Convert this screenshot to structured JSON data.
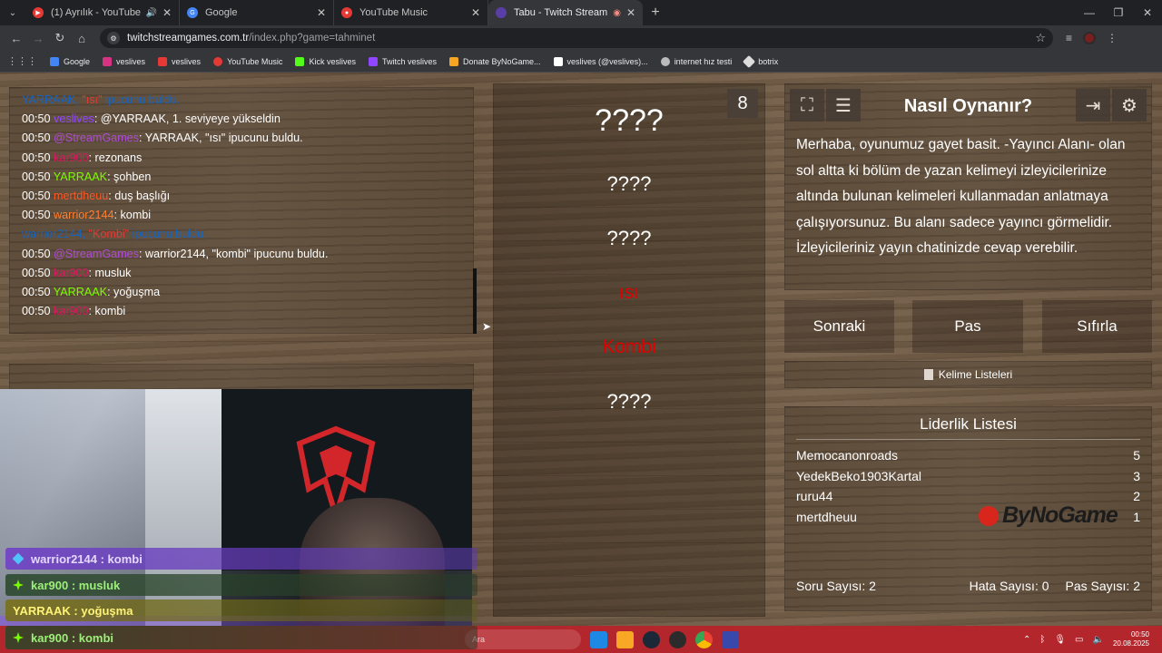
{
  "browser": {
    "tabs": [
      {
        "title": "(1) Ayrılık - YouTube",
        "fav_color": "#e53935",
        "extra": "🔊"
      },
      {
        "title": "Google",
        "fav_color": "#4285f4",
        "extra": ""
      },
      {
        "title": "YouTube Music",
        "fav_color": "#e53935",
        "extra": ""
      },
      {
        "title": "Tabu - Twitch Stream Game",
        "fav_color": "#5a3ea8",
        "extra": "◉"
      }
    ],
    "url_host": "twitchstreamgames.com.tr",
    "url_path": "/index.php?game=tahminet",
    "bookmarks": [
      {
        "label": "Google",
        "color": "#4285f4"
      },
      {
        "label": "veslives",
        "color": "#d63384"
      },
      {
        "label": "veslives",
        "color": "#e53935"
      },
      {
        "label": "YouTube Music",
        "color": "#e53935"
      },
      {
        "label": "Kick veslives",
        "color": "#53fc18"
      },
      {
        "label": "Twitch veslives",
        "color": "#9146ff"
      },
      {
        "label": "Donate ByNoGame...",
        "color": "#f5a623"
      },
      {
        "label": "veslives (@veslives)...",
        "color": "#ffffff"
      },
      {
        "label": "internet hız testi",
        "color": "#bbbbbb"
      },
      {
        "label": "botrix",
        "color": "#dddddd"
      }
    ]
  },
  "chat": {
    "lines": [
      {
        "type": "sys",
        "user": "YARRAAK",
        "sep": ",  ",
        "word": "\"ısı\"",
        "suffix": " ipucunu buldu."
      },
      {
        "type": "msg",
        "time": "00:50",
        "user": "veslives",
        "color": "#9146ff",
        "text": ": @YARRAAK, 1. seviyeye yükseldin"
      },
      {
        "type": "msg",
        "time": "00:50",
        "user": "@StreamGames",
        "color": "#b04ad6",
        "text": ": YARRAAK, \"ısı\" ipucunu buldu."
      },
      {
        "type": "msg",
        "time": "00:50",
        "user": "kar900",
        "color": "#d81b60",
        "text": ": rezonans"
      },
      {
        "type": "msg",
        "time": "00:50",
        "user": "YARRAAK",
        "color": "#7cfc00",
        "text": ": şohben"
      },
      {
        "type": "msg",
        "time": "00:50",
        "user": "mertdheuu",
        "color": "#ff5722",
        "text": ": duş başlığı"
      },
      {
        "type": "msg",
        "time": "00:50",
        "user": "warrior2144",
        "color": "#ff7f32",
        "text": ": kombi"
      },
      {
        "type": "sys",
        "user": "warrior2144",
        "sep": ",  ",
        "word": "\"Kombi\"",
        "suffix": " ipucunu buldu."
      },
      {
        "type": "msg",
        "time": "00:50",
        "user": "@StreamGames",
        "color": "#b04ad6",
        "text": ": warrior2144, \"kombi\" ipucunu buldu."
      },
      {
        "type": "msg",
        "time": "00:50",
        "user": "kar900",
        "color": "#d81b60",
        "text": ": musluk"
      },
      {
        "type": "msg",
        "time": "00:50",
        "user": "YARRAAK",
        "color": "#7cfc00",
        "text": ": yoğuşma"
      },
      {
        "type": "msg",
        "time": "00:50",
        "user": "kar900",
        "color": "#d81b60",
        "text": ": kombi"
      }
    ]
  },
  "overlay": {
    "messages": [
      "warrior2144 : kombi",
      "kar900 : musluk",
      "YARRAAK : yoğuşma",
      "kar900 : kombi"
    ]
  },
  "card": {
    "number": "8",
    "words": [
      "????",
      "????",
      "????",
      "ısı",
      "Kombi",
      "????"
    ]
  },
  "howto": {
    "title": "Nasıl Oynanır?",
    "text": "Merhaba, oyunumuz gayet basit. -Yayıncı Alanı- olan sol altta ki bölüm de yazan kelimeyi izleyicilerinize altında bulunan kelimeleri kullanmadan anlatmaya çalışıyorsunuz. Bu alanı sadece yayıncı görmelidir. İzleyicileriniz yayın chatinizde cevap verebilir."
  },
  "controls": {
    "next": "Sonraki",
    "pass": "Pas",
    "reset": "Sıfırla",
    "word_lists": "Kelime Listeleri"
  },
  "leaderboard": {
    "title": "Liderlik Listesi",
    "rows": [
      {
        "name": "Memocanonroads",
        "score": "5"
      },
      {
        "name": "YedekBeko1903Kartal",
        "score": "3"
      },
      {
        "name": "ruru44",
        "score": "2"
      },
      {
        "name": "mertdheuu",
        "score": "1"
      }
    ],
    "questions": "Soru Sayısı: 2",
    "errors": "Hata Sayısı: 0",
    "passes": "Pas Sayısı: 2",
    "sponsor": "ByNoGame"
  },
  "taskbar": {
    "search_placeholder": "Ara",
    "time": "00:50",
    "date": "20.08.2025"
  }
}
